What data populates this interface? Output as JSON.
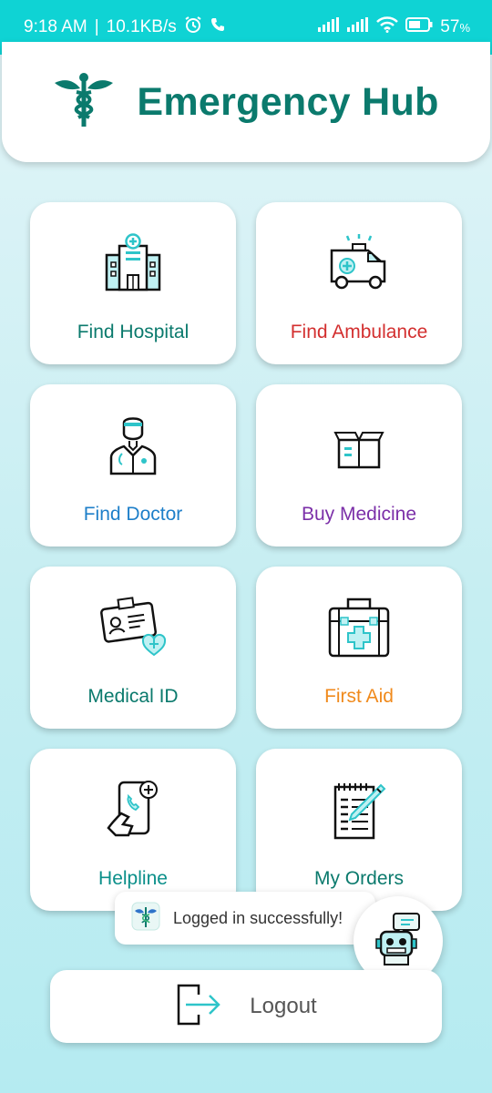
{
  "status_bar": {
    "time": "9:18 AM",
    "speed": "10.1KB/s",
    "battery": "57",
    "icons": [
      "alarm-icon",
      "phone-icon",
      "signal-icon",
      "wifi-icon",
      "battery-icon"
    ]
  },
  "header": {
    "title": "Emergency Hub",
    "logo_icon": "caduceus-icon"
  },
  "tiles": [
    {
      "label": "Find Hospital",
      "color": "#0b7a6d",
      "icon": "hospital-icon"
    },
    {
      "label": "Find Ambulance",
      "color": "#d32f2f",
      "icon": "ambulance-icon"
    },
    {
      "label": "Find Doctor",
      "color": "#1e7fc9",
      "icon": "doctor-icon"
    },
    {
      "label": "Buy Medicine",
      "color": "#7b2fa8",
      "icon": "medicine-box-icon"
    },
    {
      "label": "Medical ID",
      "color": "#0b7a6d",
      "icon": "id-card-icon"
    },
    {
      "label": "First Aid",
      "color": "#f08a1c",
      "icon": "first-aid-kit-icon"
    },
    {
      "label": "Helpline",
      "color": "#0b8f8a",
      "icon": "phone-call-icon"
    },
    {
      "label": "My Orders",
      "color": "#0b7a6d",
      "icon": "orders-icon"
    }
  ],
  "toast": {
    "message": "Logged in successfully!"
  },
  "logout": {
    "label": "Logout"
  },
  "colors": {
    "accent": "#0fd3d4",
    "brand": "#0b7a6d",
    "icon_teal": "#2ec4c9"
  }
}
